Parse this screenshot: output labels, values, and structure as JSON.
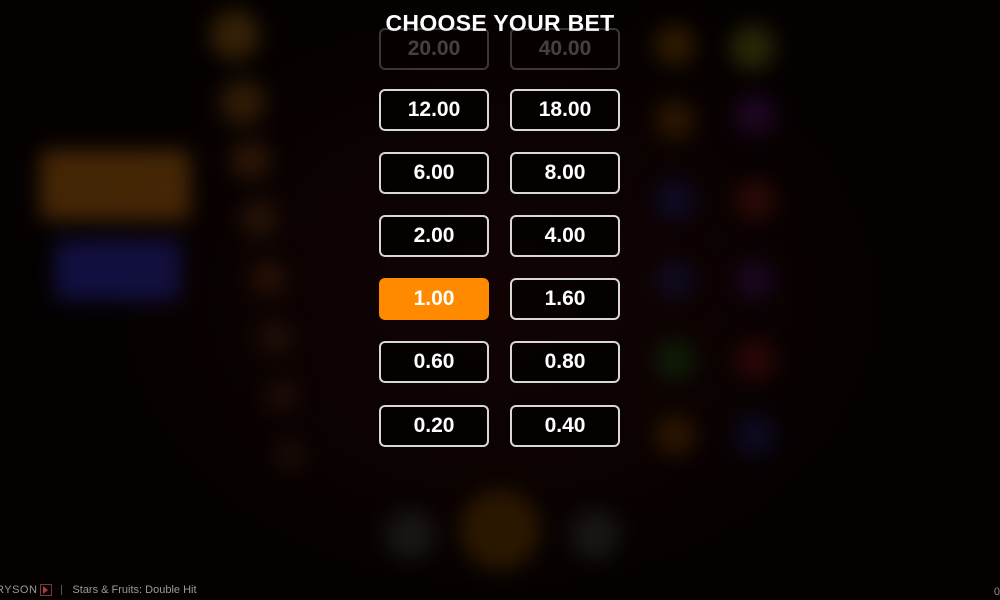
{
  "modal": {
    "title": "CHOOSE YOUR BET",
    "selected_bet": "1.00",
    "bets_left": [
      "12.00",
      "6.00",
      "2.00",
      "1.00",
      "0.60",
      "0.20"
    ],
    "bets_right": [
      "18.00",
      "8.00",
      "4.00",
      "1.60",
      "0.80",
      "0.40"
    ],
    "partially_hidden_left": "20.00",
    "partially_hidden_right": "40.00"
  },
  "footer": {
    "brand": "RYSON",
    "game_name": "Stars & Fruits: Double Hit",
    "corner_text": "0"
  },
  "colors": {
    "selected": "#ff8a00",
    "border": "#d8d8d8",
    "background": "#0a0303"
  }
}
